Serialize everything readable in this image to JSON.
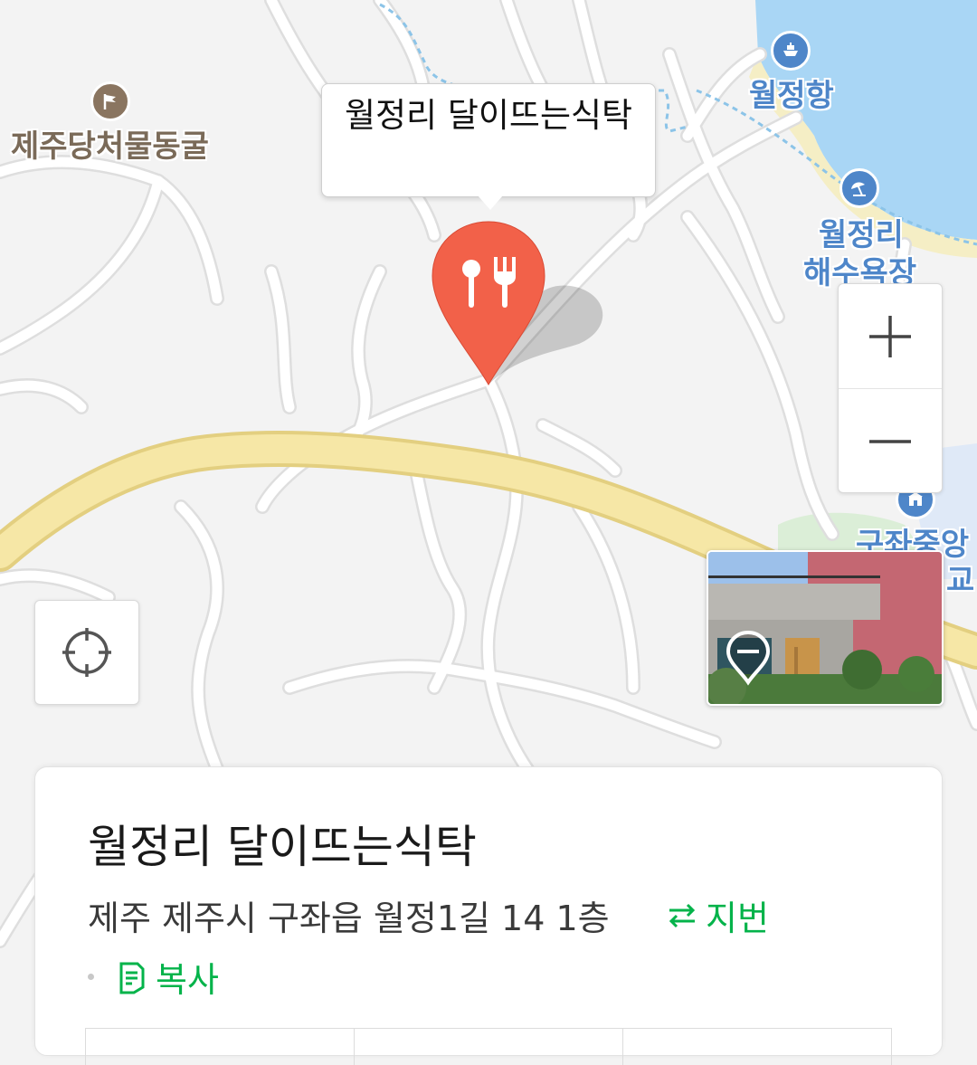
{
  "map": {
    "colors": {
      "land": "#f3f3f3",
      "road": "#ffffff",
      "road_outline": "#dedede",
      "highway": "#f6e7a6",
      "highway_outline": "#e3cf80",
      "water": "#a9d6f5",
      "beach": "#f5eec5",
      "park": "#dbeed7",
      "marker": "#f26149"
    },
    "pois": [
      {
        "name": "제주당처물동굴",
        "icon": "flag-icon",
        "color": "#8a7560"
      },
      {
        "name": "월정항",
        "icon": "ferry-icon",
        "color": "#4e86c9"
      },
      {
        "name_line1": "월정리",
        "name_line2": "해수욕장",
        "icon": "beach-umbrella-icon",
        "color": "#4e86c9"
      },
      {
        "name_line1": "구좌중앙",
        "name_line2": "교",
        "icon": "school-icon",
        "color": "#4e86c9"
      }
    ],
    "selected_marker": {
      "callout_label": "월정리 달이뜨는식탁",
      "icon": "restaurant-fork-spoon-icon"
    }
  },
  "controls": {
    "zoom_in_icon": "plus-icon",
    "zoom_out_icon": "minus-icon",
    "locate_icon": "crosshair-icon",
    "street_view_icon": "street-view-pin-icon"
  },
  "place_card": {
    "title": "월정리 달이뜨는식탁",
    "address": "제주 제주시 구좌읍 월정1길 14 1층",
    "jibun_label": "지번",
    "jibun_icon": "swap-arrows-icon",
    "copy_label": "복사",
    "copy_icon": "copy-document-icon"
  }
}
